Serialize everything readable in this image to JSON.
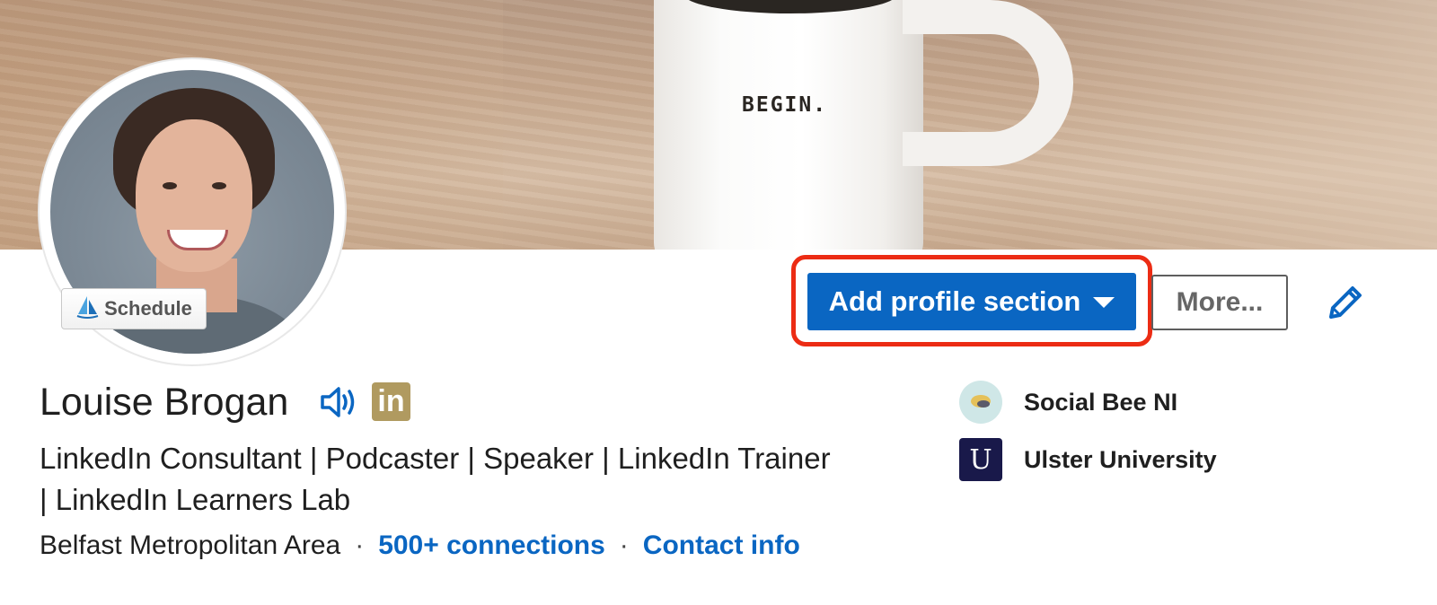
{
  "banner": {
    "mug_text": "BEGIN."
  },
  "profile": {
    "name": "Louise Brogan",
    "headline_line1": "LinkedIn Consultant | Podcaster | Speaker | LinkedIn Trainer",
    "headline_line2": "| LinkedIn Learners Lab",
    "location": "Belfast Metropolitan Area",
    "connections": "500+ connections",
    "contact_info": "Contact info",
    "separator": "·",
    "badge": "in"
  },
  "avatar": {
    "schedule_label": "Schedule"
  },
  "actions": {
    "add_profile_section": "Add profile section",
    "more": "More..."
  },
  "organizations": [
    {
      "name": "Social Bee NI",
      "logo": "bee-logo-icon"
    },
    {
      "name": "Ulster University",
      "logo": "ulster-university-logo-icon",
      "logo_text": "U"
    }
  ],
  "colors": {
    "primary_blue": "#0a66c2",
    "highlight_red": "#ec2c14",
    "linkedin_badge_gold": "#b09a60"
  }
}
